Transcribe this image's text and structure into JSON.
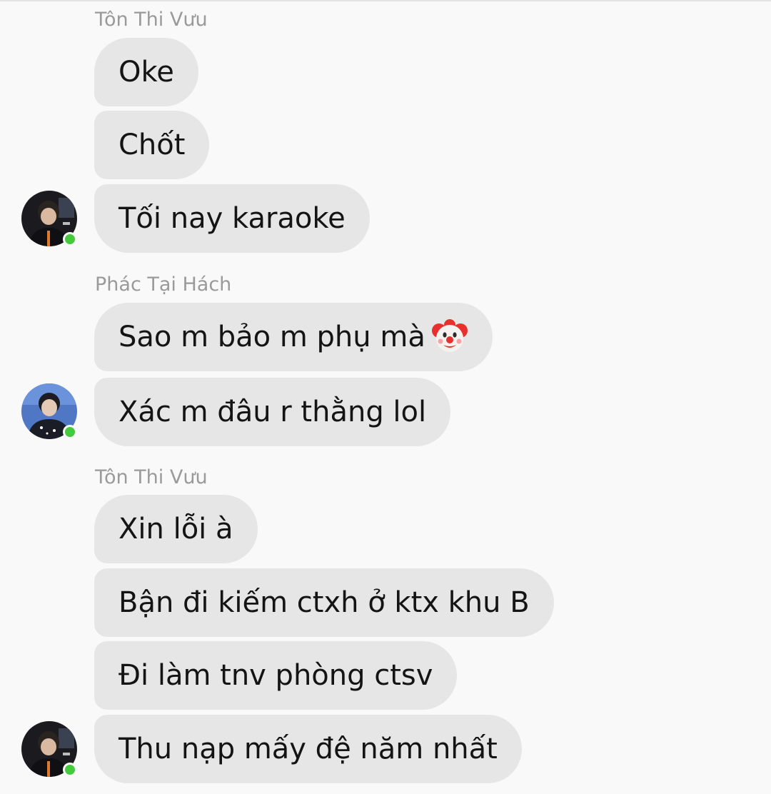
{
  "status_color": "#45c93d",
  "groups": [
    {
      "sender": "Tôn Thi Vưu",
      "messages": [
        "Oke",
        "Chốt",
        "Tối nay karaoke"
      ]
    },
    {
      "sender": "Phác Tại Hách",
      "messages": [
        "Sao m bảo m phụ mà",
        "Xác m đâu r thằng lol"
      ],
      "emoji": "clown-face"
    },
    {
      "sender": "Tôn Thi Vưu",
      "messages": [
        "Xin lỗi à",
        "Bận đi kiếm ctxh ở ktx khu B",
        "Đi làm tnv phòng ctsv",
        "Thu nạp mấy đệ năm nhất"
      ]
    }
  ]
}
